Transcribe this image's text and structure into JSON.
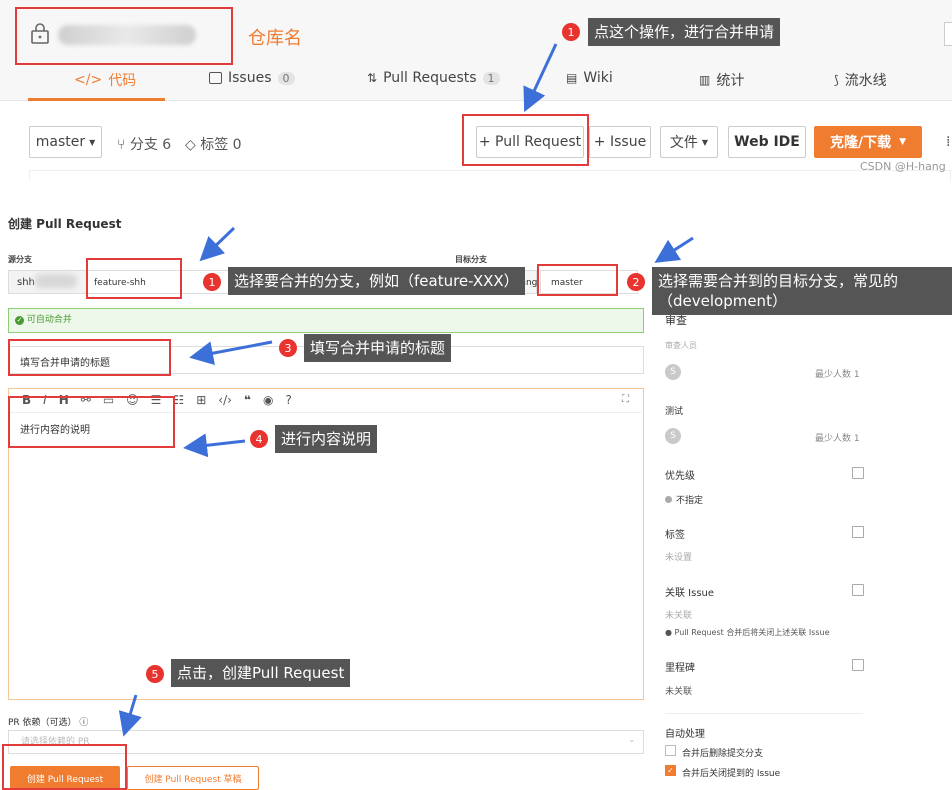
{
  "header": {
    "repo_name_label": "仓库名",
    "tabs": [
      {
        "label": "代码",
        "icon": "code-icon"
      },
      {
        "label": "Issues",
        "count": "0",
        "icon": "issues-icon"
      },
      {
        "label": "Pull Requests",
        "count": "1",
        "icon": "pull-request-icon"
      },
      {
        "label": "Wiki",
        "icon": "wiki-icon"
      },
      {
        "label": "统计",
        "icon": "stats-icon"
      },
      {
        "label": "流水线",
        "icon": "pipeline-icon"
      }
    ]
  },
  "toolbar": {
    "branch": "master",
    "branches": "分支 6",
    "tags": "标签 0",
    "pull_request": "+ Pull Request",
    "issue": "+ Issue",
    "files": "文件",
    "web_ide": "Web IDE",
    "clone": "克隆/下载",
    "watermark": "CSDN @H-hang"
  },
  "form": {
    "title": "创建 Pull Request",
    "source_label": "源分支",
    "source_repo": "shh",
    "source_branch": "feature-shh",
    "target_label": "目标分支",
    "target_repo": "g/hang",
    "target_branch": "master",
    "auto_merge": "可自动合并",
    "pr_title": "填写合并申请的标题",
    "description": "进行内容的说明",
    "pr_dep_label": "PR 依赖（可选）",
    "pr_dep_placeholder": "请选择依赖的 PR",
    "create_btn": "创建 Pull Request",
    "draft_btn": "创建 Pull Request 草稿"
  },
  "sidebar": {
    "reviewers_title": "审查",
    "reviewers_label": "审查人员",
    "reviewers_min": "最少人数 1",
    "testers_title": "测试",
    "testers_min": "最少人数 1",
    "avatar_letter": "S",
    "priority_title": "优先级",
    "priority_value": "不指定",
    "tags_title": "标签",
    "tags_value": "未设置",
    "issue_title": "关联 Issue",
    "issue_value": "未关联",
    "issue_note": "Pull Request 合并后将关闭上述关联 Issue",
    "milestone_title": "里程碑",
    "milestone_value": "未关联",
    "auto_title": "自动处理",
    "auto_opt1": "合并后删除提交分支",
    "auto_opt2": "合并后关闭提到的 Issue"
  },
  "annotations": {
    "a1": {
      "num": "1",
      "text": "点这个操作，进行合并申请"
    },
    "a1b": {
      "num": "1",
      "text": "选择要合并的分支，例如（feature-XXX）"
    },
    "a2": {
      "num": "2",
      "text": "选择需要合并到的目标分支，常见的（development）"
    },
    "a3": {
      "num": "3",
      "text": "填写合并申请的标题"
    },
    "a4": {
      "num": "4",
      "text": "进行内容说明"
    },
    "a5": {
      "num": "5",
      "text": "点击，创建Pull Request"
    }
  }
}
